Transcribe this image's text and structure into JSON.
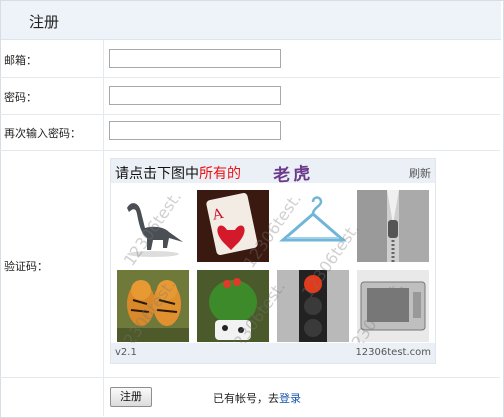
{
  "title": "注册",
  "form": {
    "email_label": "邮箱：",
    "email_value": "",
    "password_label": "密码：",
    "password_value": "",
    "confirm_label": "再次输入密码：",
    "confirm_value": "",
    "captcha_label": "验证码："
  },
  "captcha": {
    "instruction_prefix": "请点击下图中",
    "instruction_highlight": "所有的",
    "target": "老虎",
    "refresh": "刷新",
    "version": "v2.1",
    "brand": "12306test.com",
    "watermark": "12306test.",
    "images": [
      {
        "icon": "dinosaur-image"
      },
      {
        "icon": "playing-card-image"
      },
      {
        "icon": "hanger-image"
      },
      {
        "icon": "zipper-image"
      },
      {
        "icon": "tigers-image"
      },
      {
        "icon": "cactus-image"
      },
      {
        "icon": "traffic-light-image"
      },
      {
        "icon": "tv-image"
      }
    ]
  },
  "footer": {
    "submit": "注册",
    "have_account": "已有帐号，去",
    "login_link": "登录"
  },
  "colors": {
    "title_bg": "#eef3f9",
    "highlight": "#e11111",
    "link": "#1a55b0"
  }
}
